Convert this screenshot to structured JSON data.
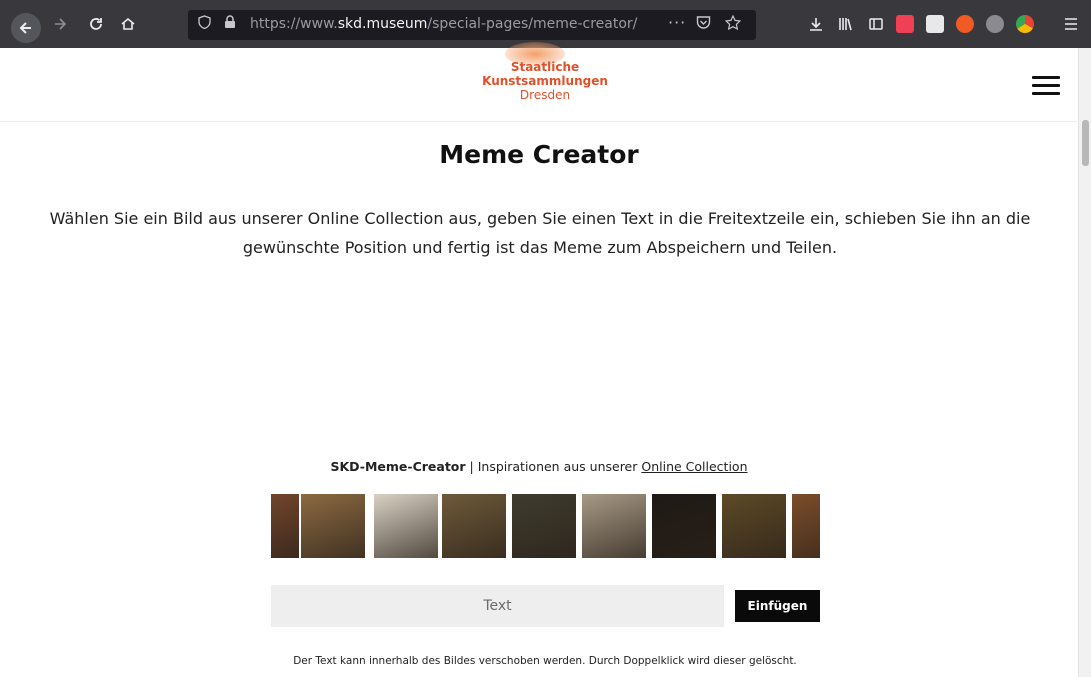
{
  "browser": {
    "url_prefix": "https://www.",
    "url_domain": "skd.museum",
    "url_path": "/special-pages/meme-creator/",
    "url_actions": "···"
  },
  "header": {
    "logo_line1": "Staatliche",
    "logo_line2": "Kunstsammlungen",
    "logo_line3": "Dresden"
  },
  "main": {
    "title": "Meme Creator",
    "intro": "Wählen Sie ein Bild aus unserer Online Collection aus, geben Sie einen Text in die Freitextzeile ein, schieben Sie ihn an die gewünschte Position und fertig ist das Meme zum Abspeichern und Teilen."
  },
  "creator": {
    "brand": "SKD-Meme-Creator",
    "separator": " | Inspirationen aus unserer ",
    "link": "Online Collection"
  },
  "gallery": [
    {
      "name": "gallery-thumb-1",
      "color": "#7a4a2e"
    },
    {
      "name": "gallery-thumb-2",
      "color": "#8c6a42"
    },
    {
      "name": "gallery-thumb-3",
      "color": "#d9d2c4"
    },
    {
      "name": "gallery-thumb-4",
      "color": "#6e5a3a"
    },
    {
      "name": "gallery-thumb-5",
      "color": "#3f3c2f"
    },
    {
      "name": "gallery-thumb-6",
      "color": "#a79a86"
    },
    {
      "name": "gallery-thumb-7",
      "color": "#1f1a16"
    },
    {
      "name": "gallery-thumb-8",
      "color": "#5d4a26"
    },
    {
      "name": "gallery-thumb-9",
      "color": "#7b4d2a"
    }
  ],
  "form": {
    "input_placeholder": "Text",
    "insert_label": "Einfügen",
    "hint": "Der Text kann innerhalb des Bildes verschoben werden. Durch Doppelklick wird dieser gelöscht."
  },
  "colors": {
    "brand_orange": "#e0512a",
    "toolbar": "#38383d",
    "button_black": "#0a0a0a"
  }
}
